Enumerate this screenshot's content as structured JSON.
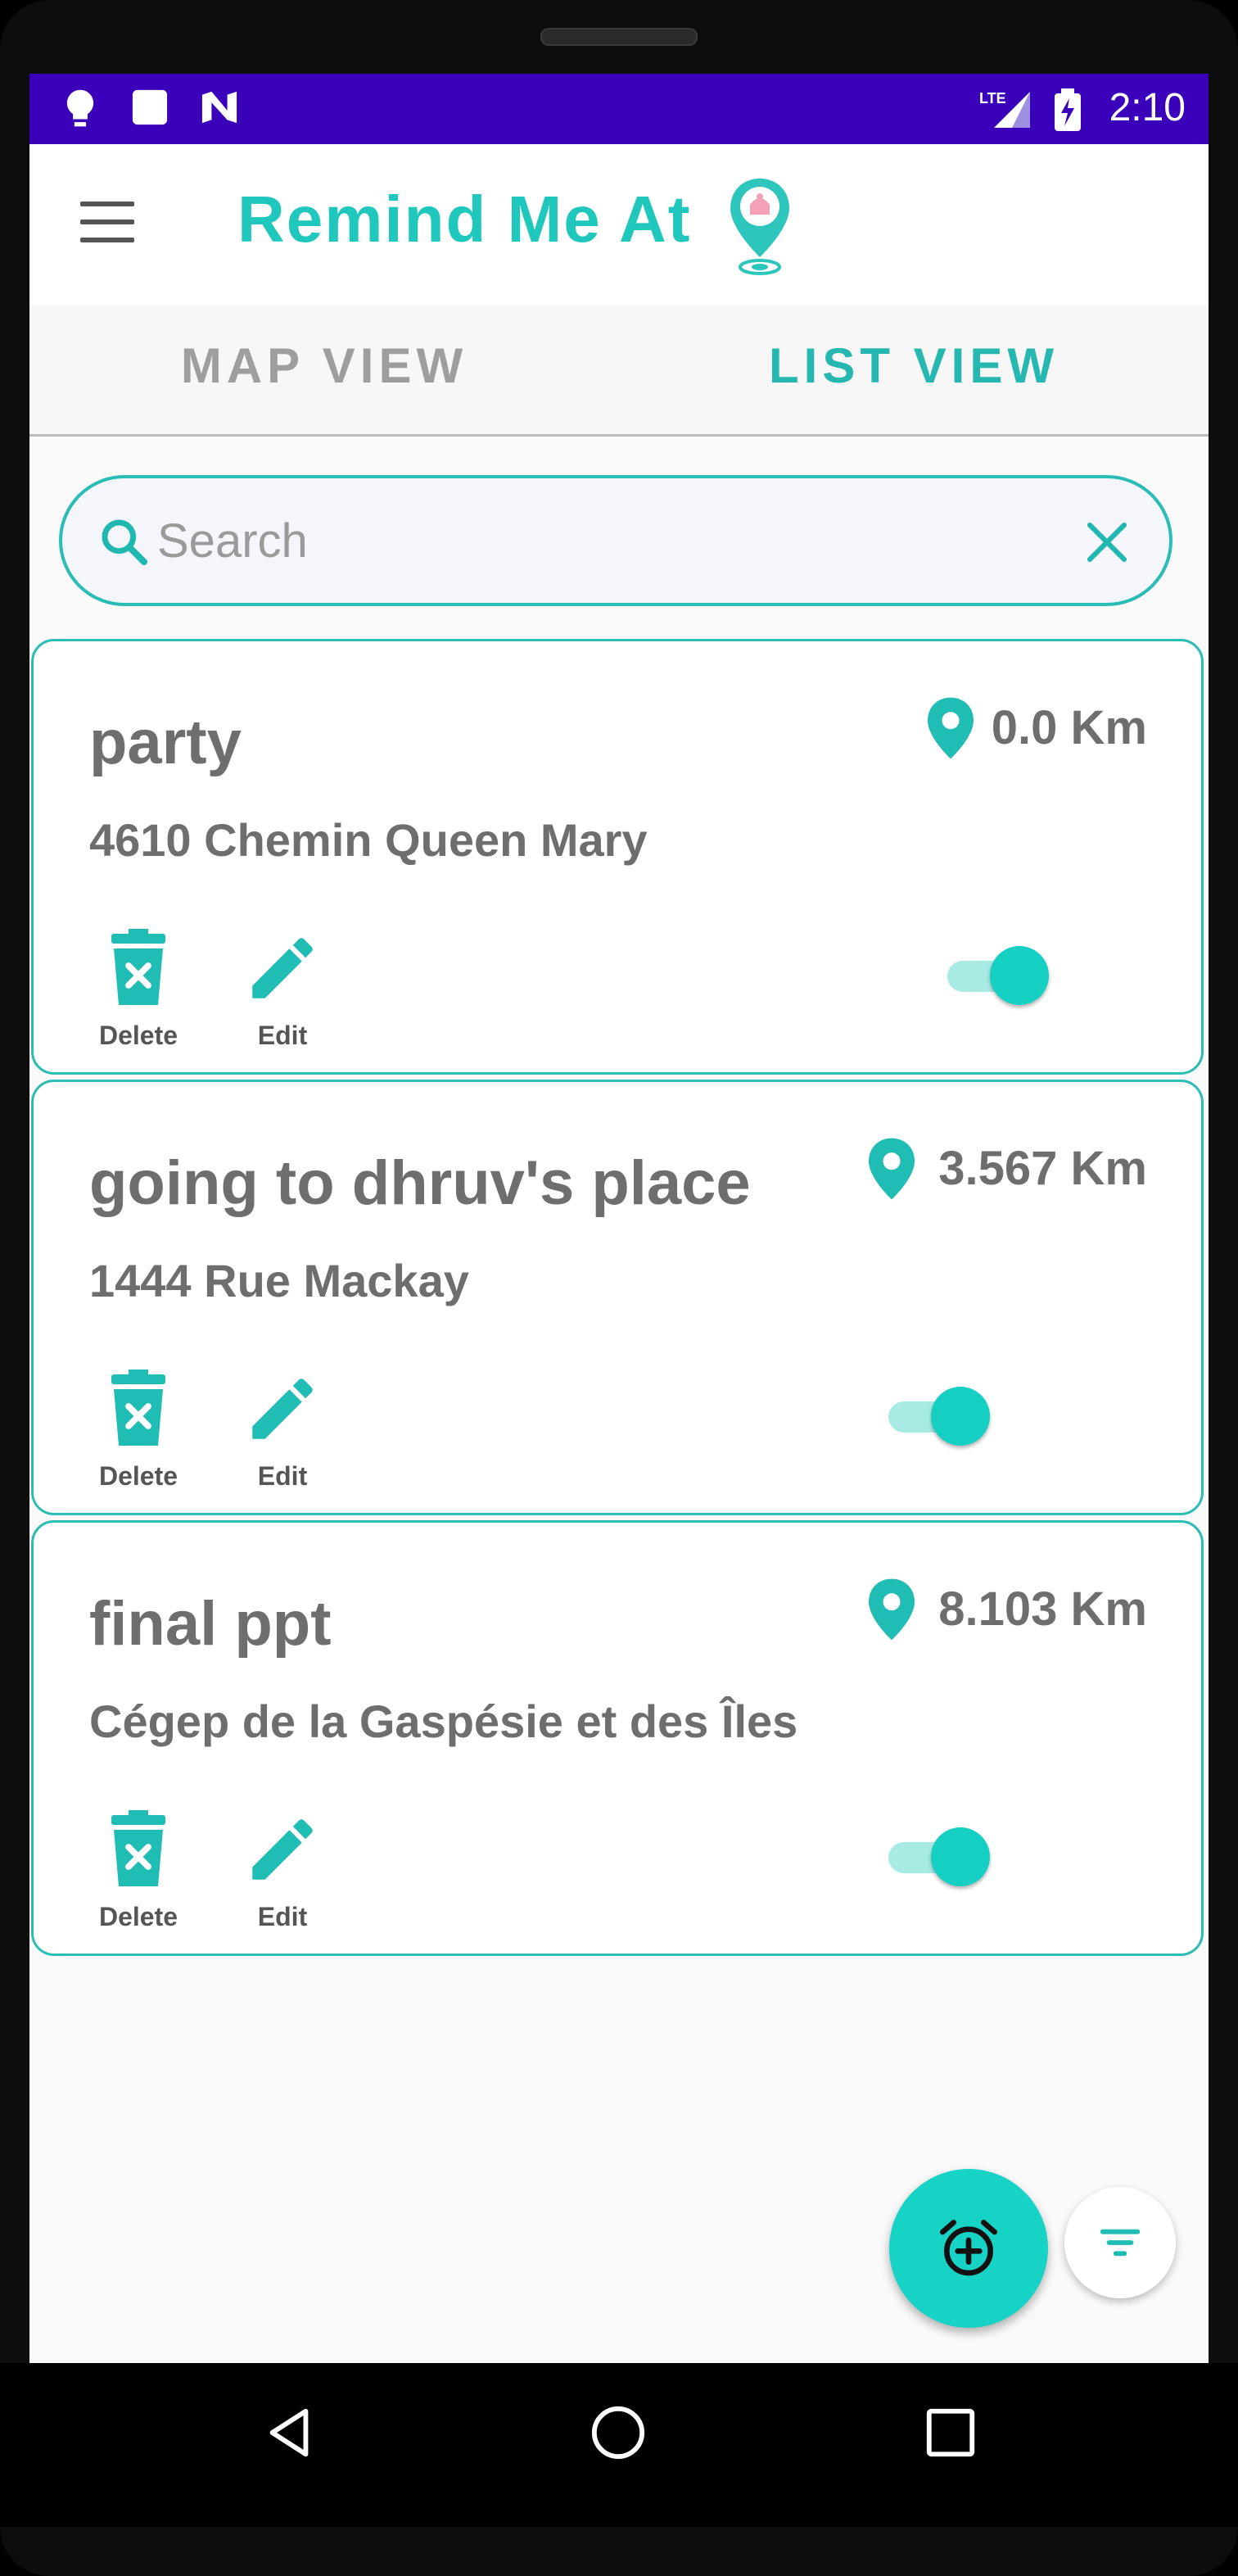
{
  "status_bar": {
    "time": "2:10",
    "network": "LTE",
    "icons": [
      "bulb-icon",
      "square-icon",
      "n-logo-icon",
      "lte-signal-icon",
      "battery-charging-icon"
    ]
  },
  "app_bar": {
    "title": "Remind Me At",
    "menu_icon": "hamburger-icon",
    "logo_icon": "location-pin-logo"
  },
  "tabs": [
    {
      "label": "MAP VIEW",
      "active": false
    },
    {
      "label": "LIST VIEW",
      "active": true
    }
  ],
  "search": {
    "placeholder": "Search",
    "value": ""
  },
  "reminders": [
    {
      "title": "party",
      "address": "4610 Chemin Queen Mary",
      "distance": "0.0 Km",
      "enabled": true,
      "delete_label": "Delete",
      "edit_label": "Edit"
    },
    {
      "title": "going to dhruv's place",
      "address": "1444 Rue Mackay",
      "distance": "3.567 Km",
      "enabled": true,
      "delete_label": "Delete",
      "edit_label": "Edit"
    },
    {
      "title": "final ppt",
      "address": "Cégep de la Gaspésie et des Îles",
      "distance": "8.103 Km",
      "enabled": true,
      "delete_label": "Delete",
      "edit_label": "Edit"
    }
  ],
  "fab": {
    "main_icon": "add-alarm-icon",
    "secondary_icon": "filter-icon"
  },
  "colors": {
    "accent": "#1fc7bd",
    "status_bar": "#3b00b9",
    "text_gray": "#6e6e6e"
  }
}
